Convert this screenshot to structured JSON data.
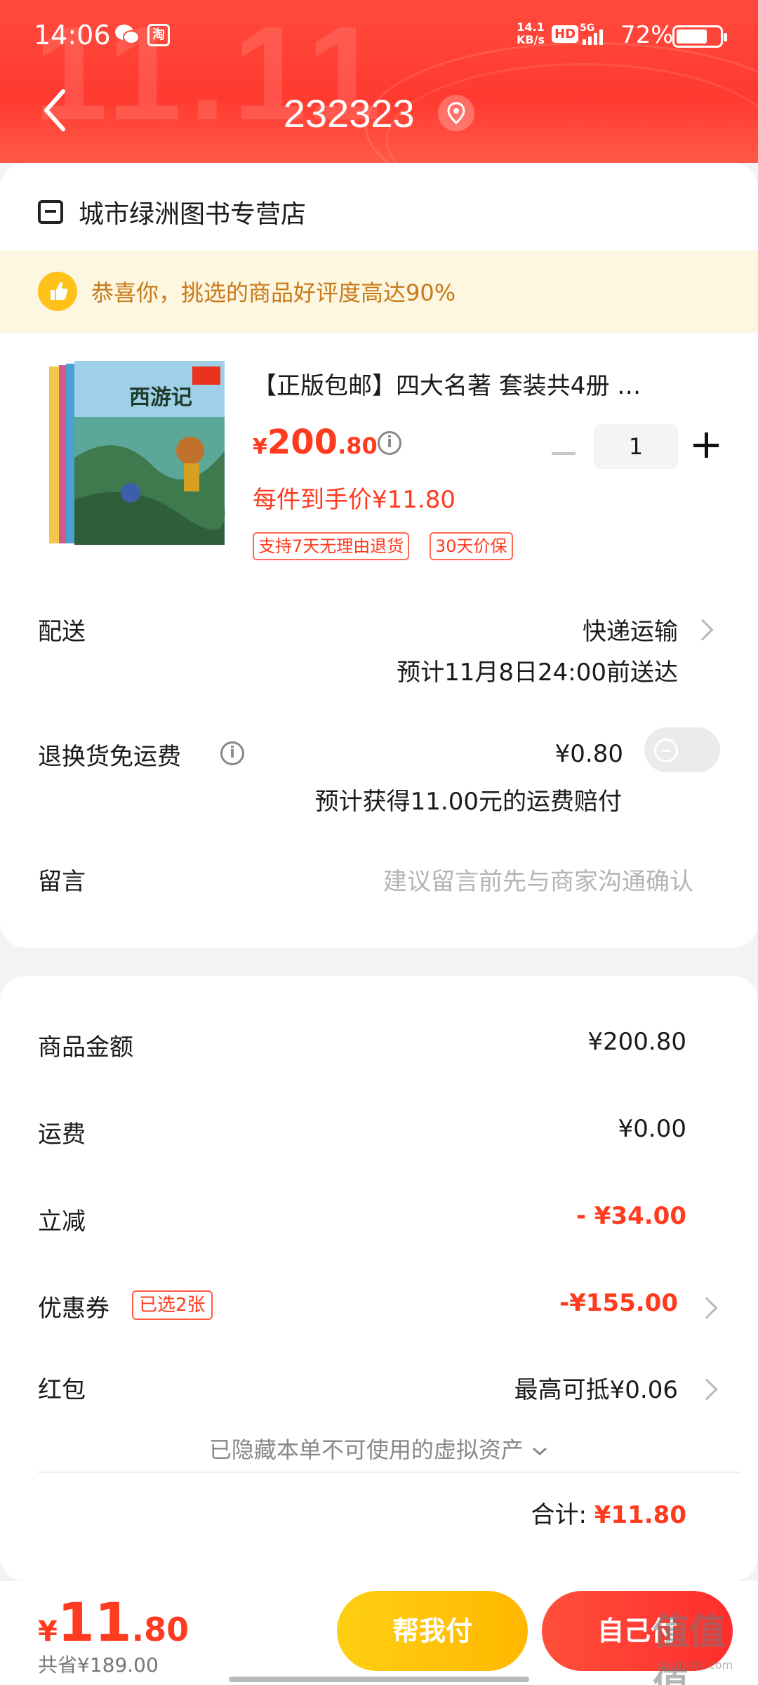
{
  "status_bar": {
    "time": "14:06",
    "net_speed": "14.1",
    "net_unit": "KB/s",
    "hd": "HD",
    "signal": "5G",
    "battery_text": "72%",
    "battery_level": 0.72,
    "taobao_badge": "淘"
  },
  "header": {
    "title": "232323"
  },
  "shop": {
    "name": "城市绿洲图书专营店"
  },
  "praise": {
    "text": "恭喜你，挑选的商品好评度高达90%"
  },
  "product": {
    "title": "【正版包邮】四大名著 套装共4册 …",
    "price_yen": "¥",
    "price_int": "200",
    "price_dec": ".80",
    "quantity": "1",
    "per_price": "每件到手价¥11.80",
    "tags": [
      "支持7天无理由退货",
      "30天价保"
    ],
    "cover_text": "西游记"
  },
  "delivery": {
    "label": "配送",
    "method": "快递运输",
    "eta": "预计11月8日24:00前送达"
  },
  "return_shipping": {
    "label": "退换货免运费",
    "price": "¥0.80",
    "note": "预计获得11.00元的运费赔付"
  },
  "message": {
    "label": "留言",
    "placeholder": "建议留言前先与商家沟通确认"
  },
  "summary": {
    "goods_label": "商品金额",
    "goods_value": "¥200.80",
    "shipping_label": "运费",
    "shipping_value": "¥0.00",
    "discount_label": "立减",
    "discount_value": "- ¥34.00",
    "coupon_label": "优惠券",
    "coupon_badge": "已选2张",
    "coupon_value": "-¥155.00",
    "redpacket_label": "红包",
    "redpacket_value": "最高可抵¥0.06",
    "hidden_assets": "已隐藏本单不可使用的虚拟资产",
    "total_label": "合计:",
    "total_value": "¥11.80"
  },
  "bottom": {
    "price_yen": "¥",
    "price_int": "11",
    "price_dec": ".80",
    "saved": "共省¥189.00",
    "help_pay": "帮我付",
    "self_pay": "自己付"
  },
  "watermark": {
    "main": "值值值",
    "sub": "zhizhizhi.com"
  }
}
